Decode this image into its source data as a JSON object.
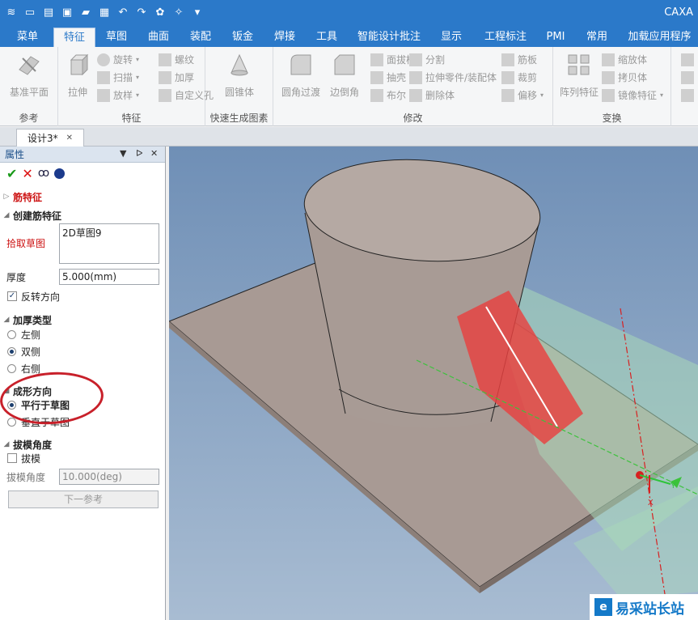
{
  "app": {
    "title": "CAXA"
  },
  "quick_access": {
    "icons": [
      "layers-icon",
      "new-icon",
      "open-icon",
      "print-icon",
      "folder-icon",
      "save-icon",
      "undo-icon",
      "redo-icon",
      "settings-icon",
      "sparkle-icon",
      "dropdown-icon"
    ]
  },
  "tabs": [
    {
      "label": "菜单",
      "active": false
    },
    {
      "label": "特征",
      "active": true
    },
    {
      "label": "草图",
      "active": false
    },
    {
      "label": "曲面",
      "active": false
    },
    {
      "label": "装配",
      "active": false
    },
    {
      "label": "钣金",
      "active": false
    },
    {
      "label": "焊接",
      "active": false
    },
    {
      "label": "工具",
      "active": false
    },
    {
      "label": "智能设计批注",
      "active": false
    },
    {
      "label": "显示",
      "active": false
    },
    {
      "label": "工程标注",
      "active": false
    },
    {
      "label": "PMI",
      "active": false
    },
    {
      "label": "常用",
      "active": false
    },
    {
      "label": "加载应用程序",
      "active": false
    }
  ],
  "ribbon": {
    "groups": {
      "reference": "参考",
      "feature": "特征",
      "quick": "快速生成图素",
      "modify": "修改",
      "transform": "变换"
    },
    "buttons": {
      "datum_plane": "基准平面",
      "extrude": "拉伸",
      "revolve": "旋转",
      "sweep": "扫描",
      "loft": "放样",
      "thread": "螺纹",
      "thicken": "加厚",
      "custom_hole": "自定义孔",
      "cone": "圆锥体",
      "fillet": "圆角过渡",
      "chamfer": "边倒角",
      "draft": "面拔模",
      "shell": "抽壳",
      "boolean": "布尔",
      "split": "分割",
      "stretch_part": "拉伸零件/装配体",
      "delete_body": "删除体",
      "rib": "筋板",
      "trim": "裁剪",
      "offset": "偏移",
      "pattern": "阵列特征",
      "scale": "缩放体",
      "copy_body": "拷贝体",
      "mirror": "镜像特征"
    }
  },
  "document": {
    "tab_label": "设计3*",
    "close": "✕"
  },
  "panel": {
    "title": "属性",
    "header_controls": [
      "▼",
      "ᐅ",
      "✕"
    ],
    "section_rib": "筋特征",
    "section_create": "创建筋特征",
    "pick_sketch_label": "拾取草图",
    "pick_sketch_value": "2D草图9",
    "thickness_label": "厚度",
    "thickness_value": "5.000(mm)",
    "reverse_label": "反转方向",
    "reverse_checked": true,
    "thicken_type_title": "加厚类型",
    "thicken_options": [
      {
        "label": "左侧",
        "selected": false
      },
      {
        "label": "双侧",
        "selected": true
      },
      {
        "label": "右侧",
        "selected": false
      }
    ],
    "form_dir_title": "成形方向",
    "form_options": [
      {
        "label": "平行于草图",
        "selected": true
      },
      {
        "label": "垂直于草图",
        "selected": false
      }
    ],
    "draft_title": "拔模角度",
    "draft_label": "拔模",
    "draft_checked": false,
    "draft_angle_label": "拔模角度",
    "draft_angle_value": "10.000(deg)",
    "next_ref_label": "下一参考"
  },
  "viewport": {
    "axis_labels": {
      "y": "Y",
      "x": "X"
    },
    "watermark_logo": "e",
    "watermark_text": "易采站长站"
  },
  "colors": {
    "titlebar": "#2b79c9",
    "model": "#a89a94",
    "rib": "#e8413f",
    "plane": "#a9d9b8"
  }
}
